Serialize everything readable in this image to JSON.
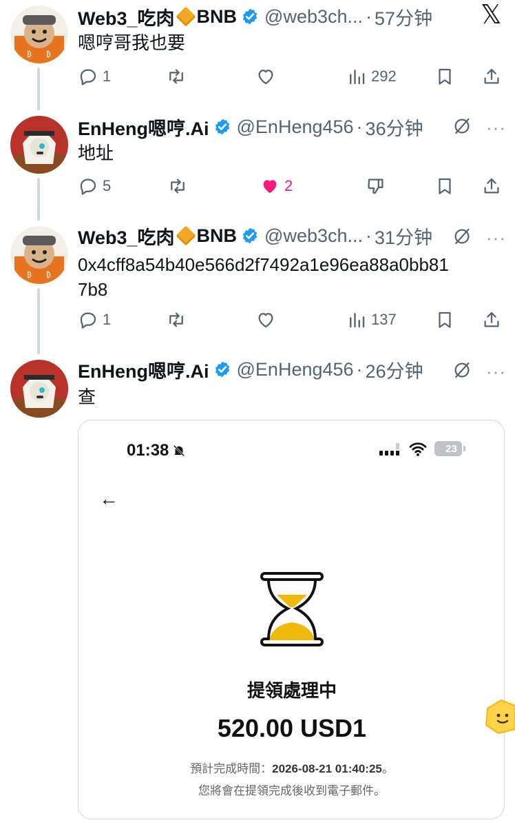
{
  "app": {
    "x_logo": "𝕏"
  },
  "tweets": [
    {
      "name": "Web3_吃肉",
      "name_suffix": "BNB",
      "handle": "@web3ch...",
      "time": "57分钟",
      "text": "嗯哼哥我也要",
      "replies": "1",
      "likes": "",
      "views": "292"
    },
    {
      "name": "EnHeng嗯哼.Ai",
      "handle": "@EnHeng456",
      "time": "36分钟",
      "text": "地址",
      "replies": "5",
      "likes": "2",
      "liked": true
    },
    {
      "name": "Web3_吃肉",
      "name_suffix": "BNB",
      "handle": "@web3ch...",
      "time": "31分钟",
      "text_line1": "0x4cff8a54b40e566d2f7492a1e96ea88a0bb81",
      "text_line2": "7b8",
      "replies": "1",
      "views": "137"
    },
    {
      "name": "EnHeng嗯哼.Ai",
      "handle": "@EnHeng456",
      "time": "26分钟",
      "text": "查"
    }
  ],
  "card": {
    "status_time": "01:38",
    "battery": "23",
    "title": "提領處理中",
    "amount": "520.00 USD1",
    "eta_label": "預計完成時間：",
    "eta_value": "2026-08-21 01:40:25",
    "eta_end": "。",
    "note": "您將會在提領完成後收到電子郵件。"
  },
  "colors": {
    "text": "#0f1419",
    "muted": "#536471",
    "verified": "#1d9bf0",
    "like": "#f91880",
    "hourglass_sand": "#f0b90b"
  }
}
